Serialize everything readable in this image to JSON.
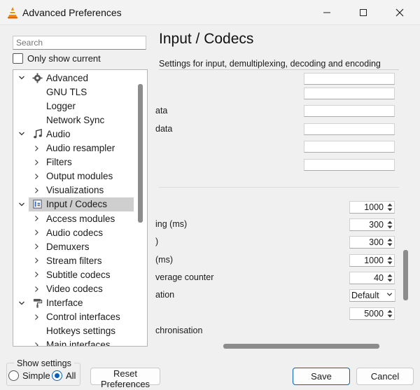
{
  "window": {
    "title": "Advanced Preferences",
    "minimize_label": "—",
    "maximize_label": "☐",
    "close_label": "✕"
  },
  "sidebar": {
    "search_placeholder": "Search",
    "only_show_current": "Only show current",
    "tree": [
      {
        "label": "Advanced",
        "icon": "gear-icon",
        "expanded": true,
        "level": 0
      },
      {
        "label": "GNU TLS",
        "level": 1
      },
      {
        "label": "Logger",
        "level": 1
      },
      {
        "label": "Network Sync",
        "level": 1
      },
      {
        "label": "Audio",
        "icon": "music-note-icon",
        "expanded": true,
        "level": 0
      },
      {
        "label": "Audio resampler",
        "level": 1,
        "expandable": true
      },
      {
        "label": "Filters",
        "level": 1,
        "expandable": true
      },
      {
        "label": "Output modules",
        "level": 1,
        "expandable": true
      },
      {
        "label": "Visualizations",
        "level": 1,
        "expandable": true
      },
      {
        "label": "Input / Codecs",
        "icon": "input-codecs-icon",
        "expanded": true,
        "level": 0,
        "selected": true
      },
      {
        "label": "Access modules",
        "level": 1,
        "expandable": true
      },
      {
        "label": "Audio codecs",
        "level": 1,
        "expandable": true
      },
      {
        "label": "Demuxers",
        "level": 1,
        "expandable": true
      },
      {
        "label": "Stream filters",
        "level": 1,
        "expandable": true
      },
      {
        "label": "Subtitle codecs",
        "level": 1,
        "expandable": true
      },
      {
        "label": "Video codecs",
        "level": 1,
        "expandable": true
      },
      {
        "label": "Interface",
        "icon": "paint-roller-icon",
        "expanded": true,
        "level": 0
      },
      {
        "label": "Control interfaces",
        "level": 1,
        "expandable": true
      },
      {
        "label": "Hotkeys settings",
        "level": 1
      },
      {
        "label": "Main interfaces",
        "level": 1,
        "expandable": true
      }
    ]
  },
  "show_settings": {
    "title": "Show settings",
    "simple_label": "Simple",
    "all_label": "All",
    "selected": "All"
  },
  "buttons": {
    "reset": "Reset Preferences",
    "save": "Save",
    "cancel": "Cancel"
  },
  "panel": {
    "title": "Input / Codecs",
    "description": "Settings for input, demultiplexing, decoding and encoding",
    "text_rows": [
      {
        "label": "",
        "value": ""
      },
      {
        "label": "",
        "value": ""
      },
      {
        "label": "ata",
        "value": ""
      },
      {
        "label": "data",
        "value": ""
      },
      {
        "label": "",
        "value": ""
      },
      {
        "label": "",
        "value": ""
      }
    ],
    "rows": [
      {
        "label": "",
        "value": "1000"
      },
      {
        "label": "ing (ms)",
        "value": "300"
      },
      {
        "label": ")",
        "value": "300"
      },
      {
        "label": "(ms)",
        "value": "1000"
      },
      {
        "label": "verage counter",
        "value": "40"
      },
      {
        "label": "ation",
        "value": "Default",
        "kind": "select"
      },
      {
        "label": "",
        "value": "5000"
      },
      {
        "label": "chronisation",
        "value": "",
        "kind": "label"
      }
    ]
  },
  "colors": {
    "accent": "#0a5fb4",
    "selected_row": "#cfcfcf",
    "scrollbar": "#8c8c8c"
  }
}
